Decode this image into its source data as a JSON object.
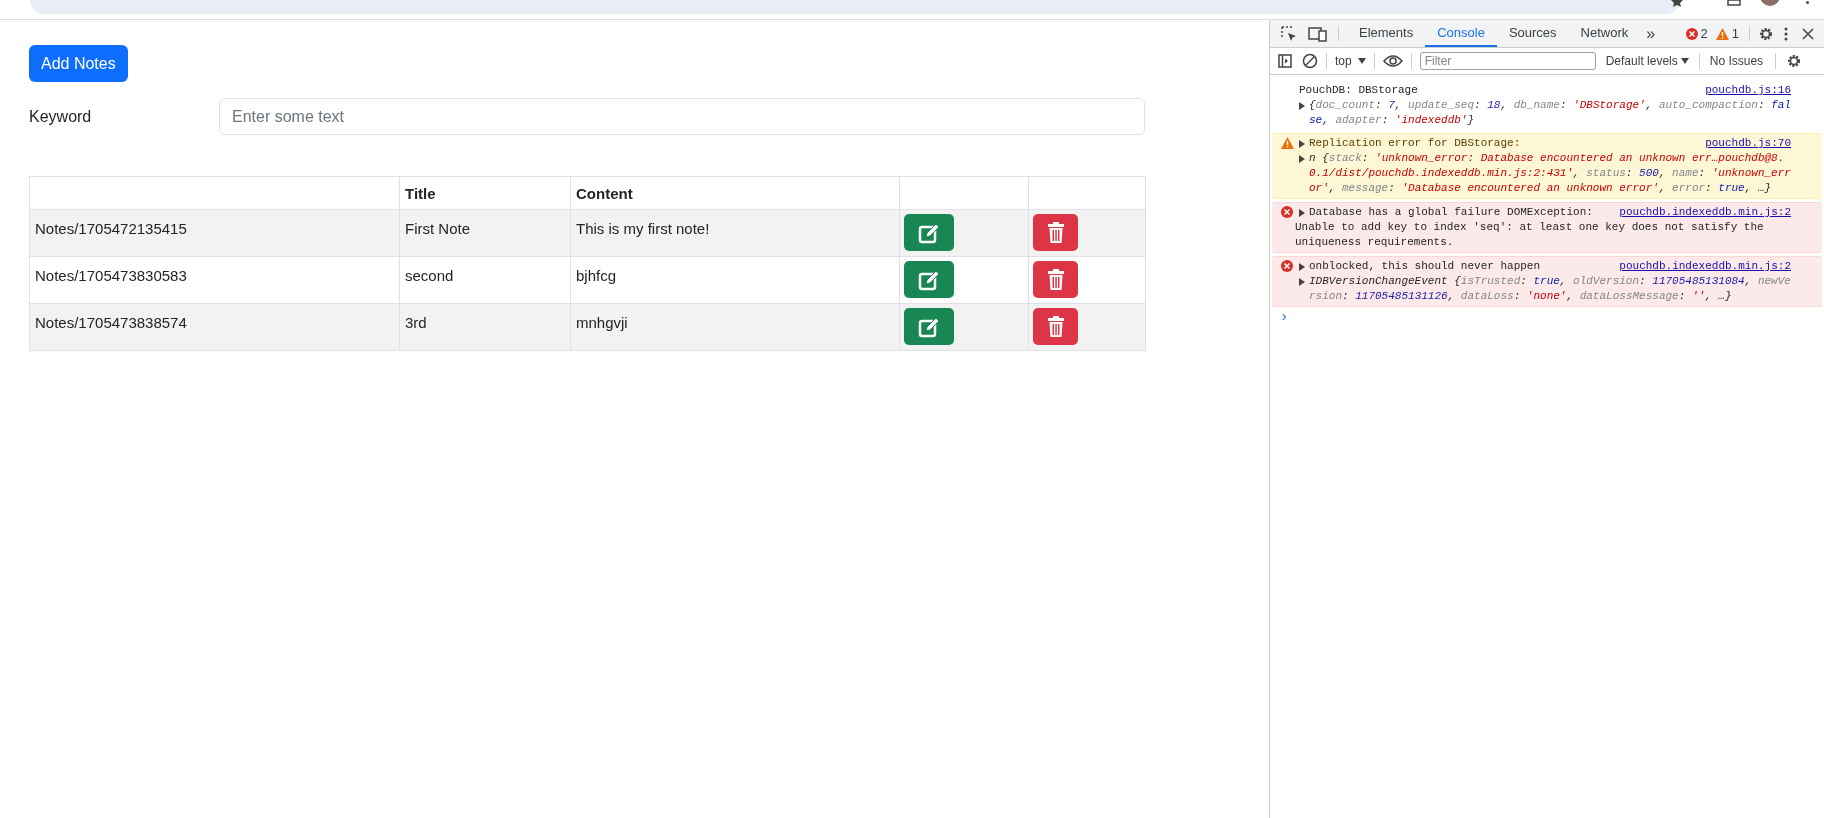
{
  "app": {
    "add_button": "Add Notes",
    "search": {
      "label": "Keyword",
      "placeholder": "Enter some text"
    },
    "table": {
      "columns": [
        "",
        "Title",
        "Content",
        "",
        ""
      ],
      "rows": [
        {
          "id": "Notes/1705472135415",
          "title": "First Note",
          "content": "This is my first note!"
        },
        {
          "id": "Notes/1705473830583",
          "title": "second",
          "content": "bjhfcg"
        },
        {
          "id": "Notes/1705473838574",
          "title": "3rd",
          "content": "mnhgvji"
        }
      ]
    }
  },
  "devtools": {
    "tabs": [
      {
        "label": "Elements",
        "selected": false
      },
      {
        "label": "Console",
        "selected": true
      },
      {
        "label": "Sources",
        "selected": false
      },
      {
        "label": "Network",
        "selected": false
      }
    ],
    "more_tabs": "»",
    "error_count": "2",
    "warning_count": "1",
    "toolbar": {
      "context": "top",
      "filter_placeholder": "Filter",
      "levels": "Default levels",
      "issues": "No Issues"
    },
    "messages": [
      {
        "kind": "info",
        "title": "PouchDB: DBStorage",
        "title_arrow": false,
        "source": "pouchdb.js:16",
        "detail": {
          "kind": "object",
          "segments": [
            {
              "kind": "punct",
              "text": "{"
            },
            {
              "kind": "key",
              "text": "doc_count"
            },
            {
              "kind": "punct",
              "text": ": "
            },
            {
              "kind": "number",
              "text": "7"
            },
            {
              "kind": "punct",
              "text": ", "
            },
            {
              "kind": "key",
              "text": "update_seq"
            },
            {
              "kind": "punct",
              "text": ": "
            },
            {
              "kind": "number",
              "text": "18"
            },
            {
              "kind": "punct",
              "text": ", "
            },
            {
              "kind": "key",
              "text": "db_name"
            },
            {
              "kind": "punct",
              "text": ": "
            },
            {
              "kind": "string",
              "text": "'DBStorage'"
            },
            {
              "kind": "punct",
              "text": ", "
            },
            {
              "kind": "key",
              "text": "auto_compaction"
            },
            {
              "kind": "punct",
              "text": ": "
            },
            {
              "kind": "bool",
              "text": "false"
            },
            {
              "kind": "punct",
              "text": ", "
            },
            {
              "kind": "key",
              "text": "adapter"
            },
            {
              "kind": "punct",
              "text": ": "
            },
            {
              "kind": "string",
              "text": "'indexeddb'"
            },
            {
              "kind": "punct",
              "text": "}"
            }
          ]
        }
      },
      {
        "kind": "warning",
        "title": "Replication error for DBStorage:",
        "title_arrow": true,
        "source": "pouchdb.js:70",
        "detail": {
          "kind": "object",
          "segments": [
            {
              "kind": "punct",
              "text": "n {"
            },
            {
              "kind": "key",
              "text": "stack"
            },
            {
              "kind": "punct",
              "text": ": "
            },
            {
              "kind": "string",
              "text": "'unknown_error: Database encountered an unknown err…pouchdb@8.0.1/dist/pouchdb.indexeddb.min.js:2:431'"
            },
            {
              "kind": "punct",
              "text": ", "
            },
            {
              "kind": "key",
              "text": "status"
            },
            {
              "kind": "punct",
              "text": ": "
            },
            {
              "kind": "number",
              "text": "500"
            },
            {
              "kind": "punct",
              "text": ", "
            },
            {
              "kind": "key",
              "text": "name"
            },
            {
              "kind": "punct",
              "text": ": "
            },
            {
              "kind": "string",
              "text": "'unknown_error'"
            },
            {
              "kind": "punct",
              "text": ", "
            },
            {
              "kind": "key",
              "text": "message"
            },
            {
              "kind": "punct",
              "text": ": "
            },
            {
              "kind": "string",
              "text": "'Database encountered an unknown error'"
            },
            {
              "kind": "punct",
              "text": ", "
            },
            {
              "kind": "key",
              "text": "error"
            },
            {
              "kind": "punct",
              "text": ": "
            },
            {
              "kind": "bool",
              "text": "true"
            },
            {
              "kind": "punct",
              "text": ", …}"
            }
          ]
        }
      },
      {
        "kind": "error",
        "title": "Database has a global failure DOMException:",
        "title_arrow": true,
        "source": "pouchdb.indexeddb.min.js:2",
        "detail": {
          "kind": "text",
          "segments": [
            {
              "kind": "plain",
              "text": "Unable to add key to index 'seq': at least one key does not satisfy the uniqueness requirements."
            }
          ]
        }
      },
      {
        "kind": "error",
        "title": "onblocked, this should never happen",
        "title_arrow": true,
        "source": "pouchdb.indexeddb.min.js:2",
        "detail": {
          "kind": "object",
          "segments": [
            {
              "kind": "punct",
              "text": "IDBVersionChangeEvent {"
            },
            {
              "kind": "key",
              "text": "isTrusted"
            },
            {
              "kind": "punct",
              "text": ": "
            },
            {
              "kind": "bool",
              "text": "true"
            },
            {
              "kind": "punct",
              "text": ", "
            },
            {
              "kind": "key",
              "text": "oldVersion"
            },
            {
              "kind": "punct",
              "text": ": "
            },
            {
              "kind": "number",
              "text": "11705485131084"
            },
            {
              "kind": "punct",
              "text": ", "
            },
            {
              "kind": "key",
              "text": "newVersion"
            },
            {
              "kind": "punct",
              "text": ": "
            },
            {
              "kind": "number",
              "text": "11705485131126"
            },
            {
              "kind": "punct",
              "text": ", "
            },
            {
              "kind": "key",
              "text": "dataLoss"
            },
            {
              "kind": "punct",
              "text": ": "
            },
            {
              "kind": "string",
              "text": "'none'"
            },
            {
              "kind": "punct",
              "text": ", "
            },
            {
              "kind": "key",
              "text": "dataLossMessage"
            },
            {
              "kind": "punct",
              "text": ": "
            },
            {
              "kind": "string",
              "text": "''"
            },
            {
              "kind": "punct",
              "text": ", …}"
            }
          ]
        }
      }
    ],
    "prompt": "›"
  }
}
